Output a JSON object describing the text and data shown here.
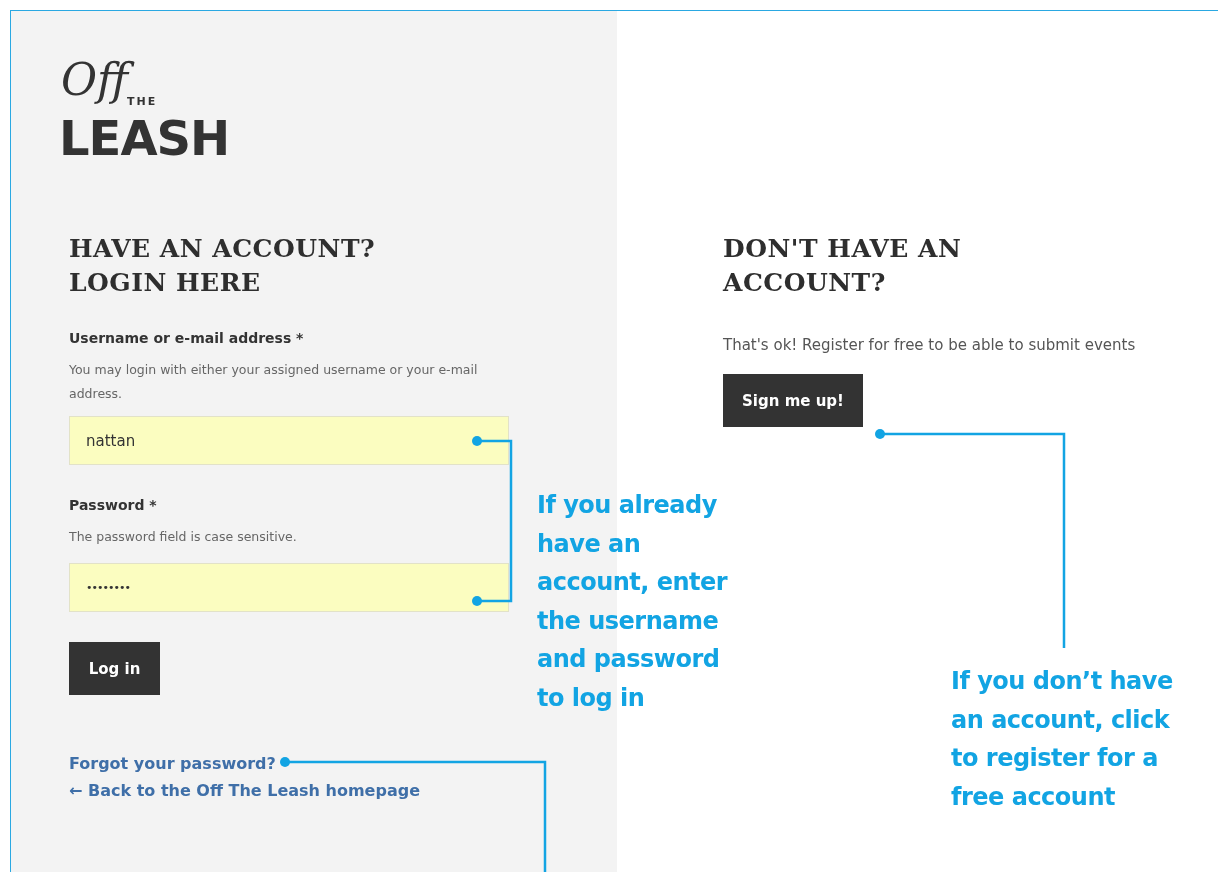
{
  "logo": {
    "script": "Off",
    "small": "THE",
    "main": "LEASH"
  },
  "login": {
    "heading": "HAVE AN ACCOUNT? LOGIN HERE",
    "fields": [
      {
        "label": "Username or e-mail address *",
        "hint": "You may login with either your assigned username or your e-mail address.",
        "value": "nattan"
      },
      {
        "label": "Password *",
        "hint": "The password field is case sensitive.",
        "value": "••••••••"
      }
    ],
    "button": "Log in",
    "links": [
      "Forgot your password?",
      "← Back to the Off The Leash homepage"
    ]
  },
  "register": {
    "heading": "DON'T HAVE AN ACCOUNT?",
    "text": "That's ok! Register for free to be able to submit events",
    "button": "Sign me up!"
  },
  "annotations": [
    "If you already have an account, enter the username and password to log in",
    "If you don’t have an account, click to register for a free account"
  ]
}
